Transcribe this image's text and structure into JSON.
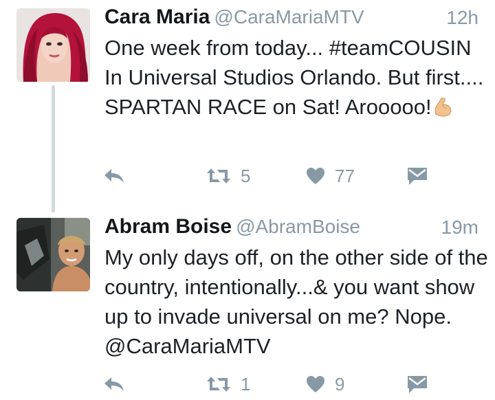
{
  "tweets": [
    {
      "name": "Cara Maria",
      "handle": "@CaraMariaMTV",
      "time": "12h",
      "text": "One week from today... #teamCOUSIN In Universal Studios Orlando. But first.... SPARTAN RACE on Sat! Arooooo!",
      "emoji": "flexed-biceps",
      "retweets": "5",
      "likes": "77"
    },
    {
      "name": "Abram Boise",
      "handle": "@AbramBoise",
      "time": "19m",
      "text": "My only days off, on the other side of the country, intentionally...& you want show up to invade universal on me? Nope. @CaraMariaMTV",
      "retweets": "1",
      "likes": "9"
    }
  ],
  "icons": {
    "reply": "reply-icon",
    "retweet": "retweet-icon",
    "like": "heart-icon",
    "dm": "direct-message-icon"
  },
  "colors": {
    "icon_gray": "#8899a6",
    "thread_line": "#cfd9de",
    "name": "#14171a"
  }
}
